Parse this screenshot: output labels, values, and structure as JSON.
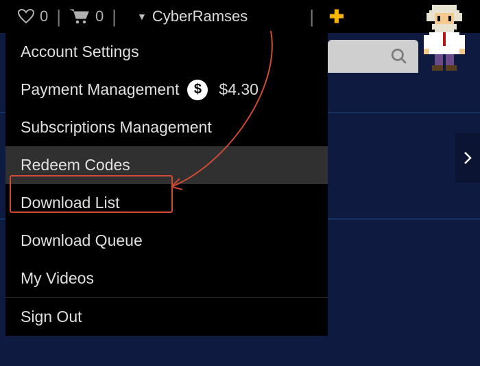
{
  "topbar": {
    "wishlist_count": "0",
    "cart_count": "0",
    "username": "CyberRamses"
  },
  "menu": {
    "items": [
      {
        "label": "Account Settings"
      },
      {
        "label": "Payment Management",
        "balance": "$4.30"
      },
      {
        "label": "Subscriptions Management"
      },
      {
        "label": "Redeem Codes"
      },
      {
        "label": "Download List"
      },
      {
        "label": "Download Queue"
      },
      {
        "label": "My Videos"
      },
      {
        "label": "Sign Out"
      }
    ]
  },
  "annotation": {
    "highlighted_item": "Redeem Codes"
  },
  "colors": {
    "bg_navy": "#0e1a3f",
    "callout_red": "#d14a34",
    "plus_orange": "#f9b600"
  }
}
